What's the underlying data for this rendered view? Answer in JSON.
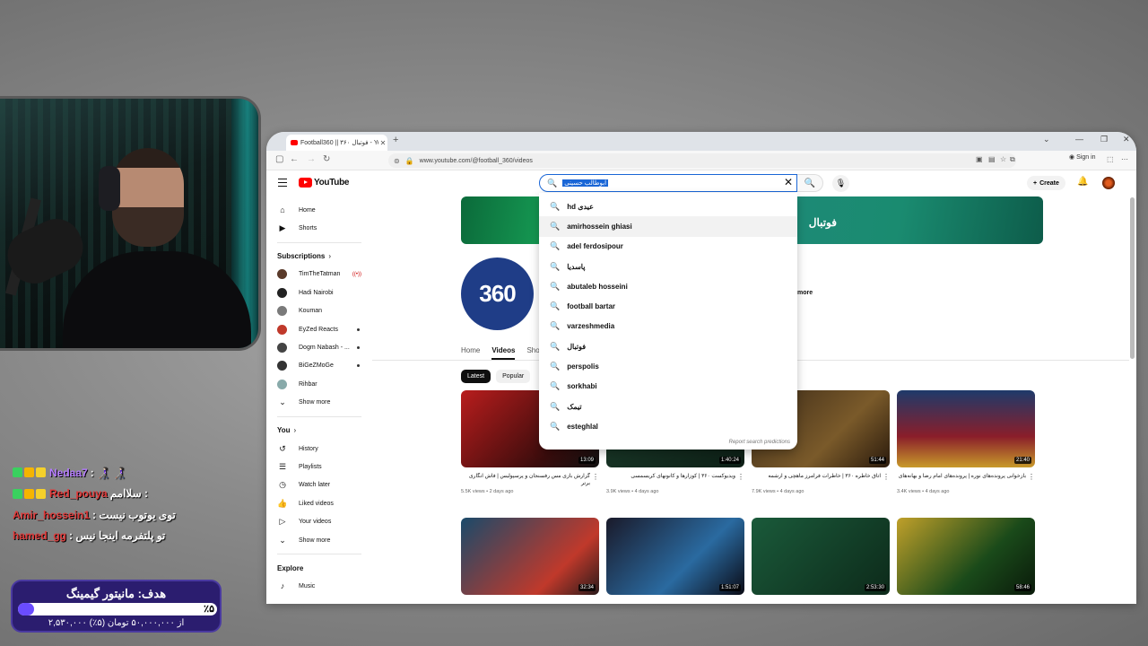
{
  "chat": [
    {
      "user": "Nedaa7",
      "message": ": 👩🏻‍🦯 👩🏻‍🦯",
      "color": "#b57cff"
    },
    {
      "user": "Red_pouya",
      "message": "سلاامم :",
      "color": "#e03a3a"
    },
    {
      "user": "Amir_hossein1",
      "message": ": توی یوتوب نیست",
      "color": "#e03a3a"
    },
    {
      "user": "hamed_gg",
      "message": ": تو پلتفرمه اینجا نیس",
      "color": "#e03a3a"
    }
  ],
  "goal": {
    "title": "هدف: مانیتور گیمینگ",
    "percent_label": "٪۵",
    "fraction": 0.05,
    "subtitle": "۲,۵۳۰,۰۰۰ از ۵۰,۰۰۰,۰۰۰ تومان (۵٪)"
  },
  "browser": {
    "tab_title": "Football360 || ۳۶۰ فوتبال - YouTube",
    "tab_close": "✕",
    "new_tab": "+",
    "url": "www.youtube.com/@football_360/videos",
    "signin": "Sign in"
  },
  "youtube": {
    "logo": "YouTube",
    "search": {
      "query": "ابوطالب حسینی",
      "clear": "✕"
    },
    "create": "Create",
    "sidebar": {
      "main": [
        {
          "label": "Home",
          "icon": "⌂"
        },
        {
          "label": "Shorts",
          "icon": "▶"
        }
      ],
      "subscriptions_title": "Subscriptions",
      "subscriptions": [
        {
          "label": "TimTheTatman",
          "color": "#5a3a2a",
          "indicator": "live"
        },
        {
          "label": "Hadi Nairobi",
          "color": "#222",
          "indicator": ""
        },
        {
          "label": "Kouman",
          "color": "#7a7a7a",
          "indicator": ""
        },
        {
          "label": "EyZed Reacts",
          "color": "#c0392b",
          "indicator": "new"
        },
        {
          "label": "Dogm Nabash - ...",
          "color": "#444",
          "indicator": "new"
        },
        {
          "label": "BiGeZMoGe",
          "color": "#333",
          "indicator": "new"
        },
        {
          "label": "Rihbar",
          "color": "#8aa",
          "indicator": ""
        }
      ],
      "show_more_1": "Show more",
      "you_title": "You",
      "you_items": [
        {
          "label": "History",
          "icon": "↺"
        },
        {
          "label": "Playlists",
          "icon": "☰"
        },
        {
          "label": "Watch later",
          "icon": "◷"
        },
        {
          "label": "Liked videos",
          "icon": "👍"
        },
        {
          "label": "Your videos",
          "icon": "▷"
        }
      ],
      "show_more_2": "Show more",
      "explore_title": "Explore",
      "explore_items": [
        {
          "label": "Music",
          "icon": "♪"
        }
      ]
    },
    "banner_text": "فوتبال",
    "channel_logo": "360",
    "more_link": "more",
    "channel_tabs": [
      "Home",
      "Videos",
      "Sho"
    ],
    "chips": [
      "Latest",
      "Popular"
    ],
    "suggestions": [
      "hd عیدی",
      "amirhossein ghiasi",
      "adel ferdosipour",
      "پاسدیا",
      "abutaleb hosseini",
      "football bartar",
      "varzeshmedia",
      "فوتبال",
      "perspolis",
      "sorkhabi",
      "تیمک",
      "esteghlal"
    ],
    "report": "Report search predictions",
    "videos": [
      {
        "duration": "13:09",
        "title": "گزارش بازی مس رفسنجان و پرسپولیس | فاش انگاری برتر",
        "meta": "5.5K views • 2 days ago",
        "bg": "linear-gradient(135deg,#b81d1d,#3a0c0c 70%,#111)"
      },
      {
        "duration": "1:40:24",
        "title": "ویدیوکست ۳۶۰ | کوزارها و کانونهای کریسمسی",
        "meta": "3.9K views • 4 days ago",
        "bg": "linear-gradient(135deg,#1b3b2a,#0d1f16)"
      },
      {
        "duration": "51:44",
        "title": "اتاق خاطره ۳۶۰ | خاطرات فرامرز ماهچی و آرشمه",
        "meta": "7.9K views • 4 days ago",
        "bg": "linear-gradient(135deg,#3b2a18,#7a5a2a 60%,#2a1a0c)"
      },
      {
        "duration": "21:40",
        "title": "بازخوانی پرونده‌های نوره | پرونده‌های امام رضا و بهانه‌های",
        "meta": "3.4K views • 4 days ago",
        "bg": "linear-gradient(180deg,#1e3a6a,#8a1e2a 60%,#c89a2a)"
      },
      {
        "duration": "32:34",
        "title": "",
        "meta": "",
        "bg": "linear-gradient(135deg,#1a4a6a,#c0392b 70%,#2a1a1a)"
      },
      {
        "duration": "1:51:07",
        "title": "",
        "meta": "",
        "bg": "linear-gradient(135deg,#1a1a2a,#2a6aa0 60%,#0a0a14)"
      },
      {
        "duration": "2:53:30",
        "title": "",
        "meta": "",
        "bg": "linear-gradient(135deg,#1a5a3a,#0d2a1a)"
      },
      {
        "duration": "58:46",
        "title": "",
        "meta": "",
        "bg": "linear-gradient(135deg,#c0a02a,#1a4a1a 60%,#0a1a0a)"
      }
    ]
  }
}
